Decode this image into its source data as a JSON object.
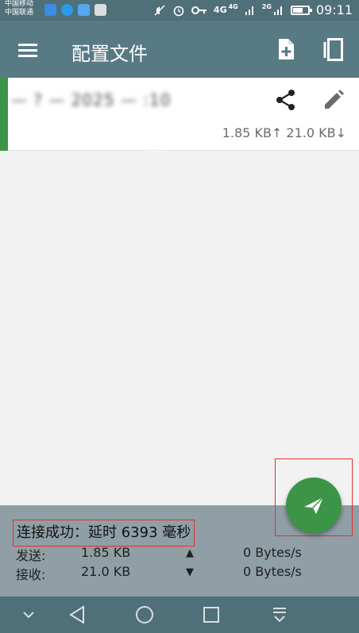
{
  "status_bar": {
    "carrier_line1": "中国移动",
    "carrier_line2": "中国联通",
    "net1": "4G",
    "net1_sup": "4G",
    "net2_sup": "2G",
    "time": "09:11",
    "icons": [
      "app-notification-icon",
      "chat-notification-icon",
      "app-notification-icon",
      "gallery-notification-icon",
      "mute-icon",
      "alarm-icon",
      "vpn-key-icon",
      "signal-icon",
      "signal-icon",
      "battery-icon"
    ]
  },
  "app_bar": {
    "title": "配置文件",
    "actions": [
      "menu-icon",
      "new-file-icon",
      "copy-icon"
    ]
  },
  "profile": {
    "name": "— ? — 2025 — :10",
    "traffic": "1.85 KB↑ 21.0 KB↓",
    "actions": [
      "share-icon",
      "edit-icon"
    ]
  },
  "connection": {
    "status": "连接成功：延时 6393 毫秒",
    "upload": {
      "label": "发送:",
      "total": "1.85 KB",
      "arrow": "▲",
      "speed": "0 Bytes/s"
    },
    "download": {
      "label": "接收:",
      "total": "21.0 KB",
      "arrow": "▼",
      "speed": "0 Bytes/s"
    }
  },
  "fab": {
    "icon": "send-icon"
  },
  "colors": {
    "status_bar": "#4f6f79",
    "app_bar": "#587a84",
    "accent_green": "#3c9447",
    "bottom_panel": "#8f9fa5",
    "highlight_red": "#e23030"
  }
}
